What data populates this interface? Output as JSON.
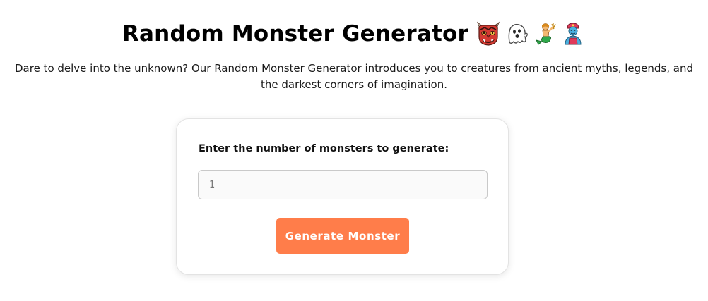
{
  "header": {
    "title": "Random Monster Generator",
    "emojis": [
      "ogre-icon",
      "ghost-icon",
      "merperson-icon",
      "genie-icon"
    ]
  },
  "intro": {
    "text": "Dare to delve into the unknown? Our Random Monster Generator introduces you to creatures from ancient myths, legends, and the darkest corners of imagination."
  },
  "form": {
    "count_label": "Enter the number of monsters to generate:",
    "count_value": "",
    "count_placeholder": "1",
    "generate_label": "Generate Monster"
  },
  "colors": {
    "accent": "#ff7d4a",
    "card_border": "#e3e3e3"
  }
}
